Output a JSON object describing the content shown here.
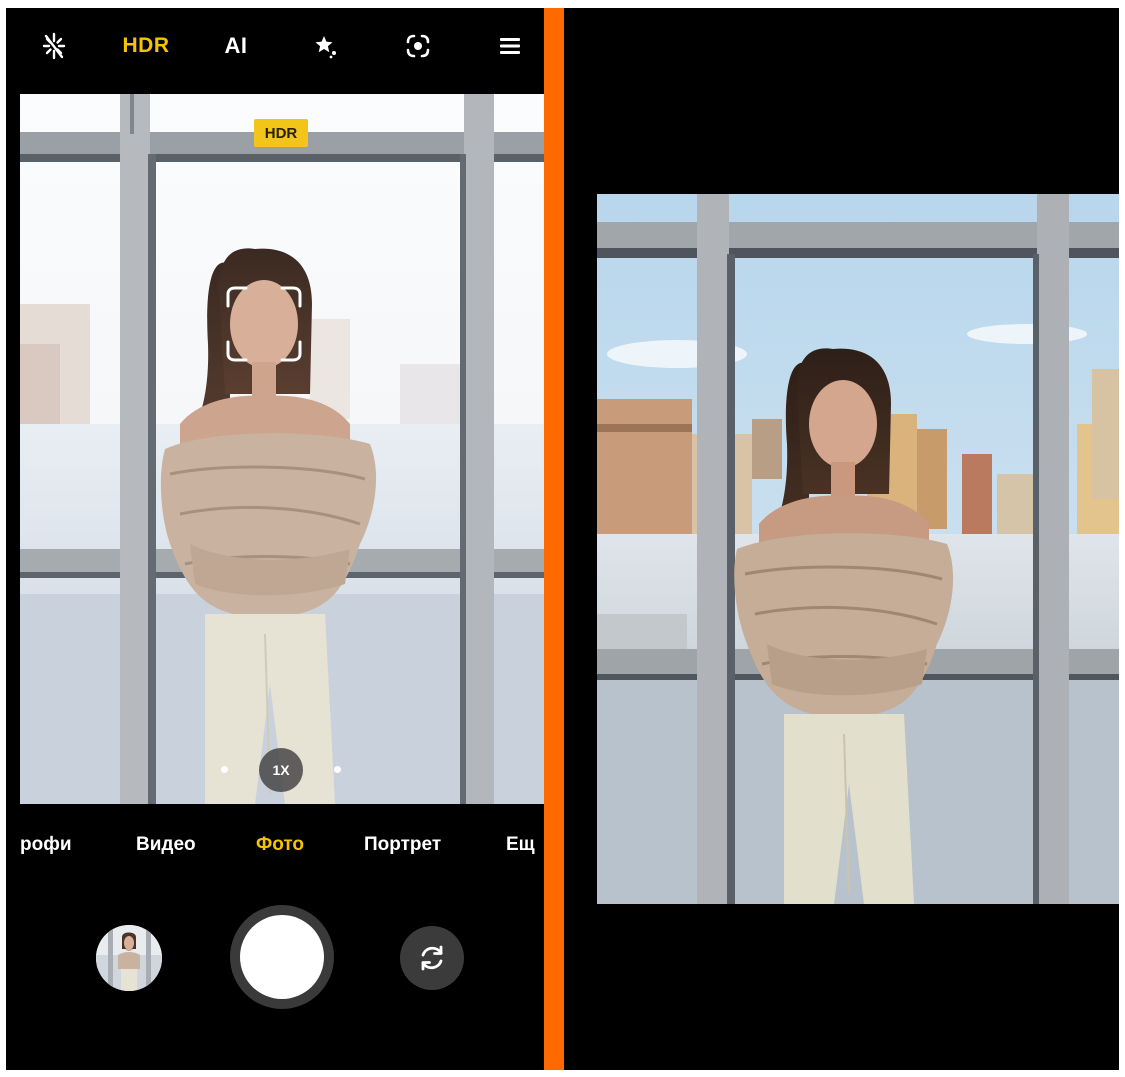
{
  "camera": {
    "topbar": {
      "hdr_label": "HDR",
      "ai_label": "AI"
    },
    "hdr_badge": "HDR",
    "zoom_label": "1X",
    "modes": [
      "рофи",
      "Видео",
      "Фото",
      "Портрет",
      "Ещ"
    ],
    "active_mode": "Фото",
    "accent_color": "#f5c400"
  },
  "divider_color": "#ff6a00",
  "icons": [
    "flash-off-icon",
    "effects-icon",
    "focus-icon",
    "menu-icon",
    "switch-camera-icon"
  ]
}
